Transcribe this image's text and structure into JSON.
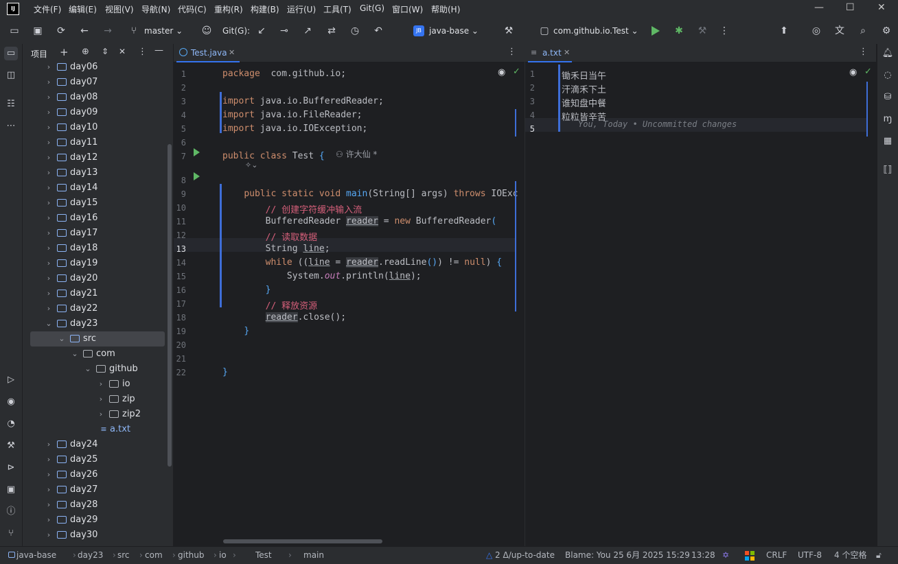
{
  "menu": [
    "文件(F)",
    "编辑(E)",
    "视图(V)",
    "导航(N)",
    "代码(C)",
    "重构(R)",
    "构建(B)",
    "运行(U)",
    "工具(T)",
    "Git(G)",
    "窗口(W)",
    "帮助(H)"
  ],
  "logo_text": "IJ",
  "toolbar": {
    "branch": "master",
    "git_label": "Git(G):",
    "project_badge": "JB",
    "project_name": "java-base",
    "run_config": "com.github.io.Test"
  },
  "project_panel": {
    "title": "项目",
    "tree": [
      {
        "label": "day06",
        "type": "folder",
        "depth": 1,
        "expanded": false
      },
      {
        "label": "day07",
        "type": "folder",
        "depth": 1,
        "expanded": false
      },
      {
        "label": "day08",
        "type": "folder",
        "depth": 1,
        "expanded": false
      },
      {
        "label": "day09",
        "type": "folder",
        "depth": 1,
        "expanded": false
      },
      {
        "label": "day10",
        "type": "folder",
        "depth": 1,
        "expanded": false
      },
      {
        "label": "day11",
        "type": "folder",
        "depth": 1,
        "expanded": false
      },
      {
        "label": "day12",
        "type": "folder",
        "depth": 1,
        "expanded": false
      },
      {
        "label": "day13",
        "type": "folder",
        "depth": 1,
        "expanded": false
      },
      {
        "label": "day14",
        "type": "folder",
        "depth": 1,
        "expanded": false
      },
      {
        "label": "day15",
        "type": "folder",
        "depth": 1,
        "expanded": false
      },
      {
        "label": "day16",
        "type": "folder",
        "depth": 1,
        "expanded": false
      },
      {
        "label": "day17",
        "type": "folder",
        "depth": 1,
        "expanded": false
      },
      {
        "label": "day18",
        "type": "folder",
        "depth": 1,
        "expanded": false
      },
      {
        "label": "day19",
        "type": "folder",
        "depth": 1,
        "expanded": false
      },
      {
        "label": "day20",
        "type": "folder",
        "depth": 1,
        "expanded": false
      },
      {
        "label": "day21",
        "type": "folder",
        "depth": 1,
        "expanded": false
      },
      {
        "label": "day22",
        "type": "folder",
        "depth": 1,
        "expanded": false
      },
      {
        "label": "day23",
        "type": "folder",
        "depth": 1,
        "expanded": true
      },
      {
        "label": "src",
        "type": "src",
        "depth": 2,
        "expanded": true,
        "selected": true
      },
      {
        "label": "com",
        "type": "package",
        "depth": 3,
        "expanded": true
      },
      {
        "label": "github",
        "type": "package",
        "depth": 4,
        "expanded": true
      },
      {
        "label": "io",
        "type": "package",
        "depth": 5,
        "expanded": false
      },
      {
        "label": "zip",
        "type": "package",
        "depth": 5,
        "expanded": false
      },
      {
        "label": "zip2",
        "type": "package",
        "depth": 5,
        "expanded": false
      },
      {
        "label": "a.txt",
        "type": "file",
        "depth": 3,
        "expanded": null
      },
      {
        "label": "day24",
        "type": "folder",
        "depth": 1,
        "expanded": false
      },
      {
        "label": "day25",
        "type": "folder",
        "depth": 1,
        "expanded": false
      },
      {
        "label": "day26",
        "type": "folder",
        "depth": 1,
        "expanded": false
      },
      {
        "label": "day27",
        "type": "folder",
        "depth": 1,
        "expanded": false
      },
      {
        "label": "day28",
        "type": "folder",
        "depth": 1,
        "expanded": false
      },
      {
        "label": "day29",
        "type": "folder",
        "depth": 1,
        "expanded": false
      },
      {
        "label": "day30",
        "type": "folder",
        "depth": 1,
        "expanded": false
      }
    ]
  },
  "editor_left": {
    "tab": "Test.java",
    "author_hint": "许大仙 *",
    "lines": [
      [
        [
          "kw",
          "package"
        ],
        [
          "",
          "  com.github.io;"
        ]
      ],
      [],
      [
        [
          "kw",
          "import"
        ],
        [
          "",
          " java.io.BufferedReader;"
        ]
      ],
      [
        [
          "kw",
          "import"
        ],
        [
          "",
          " java.io.FileReader;"
        ]
      ],
      [
        [
          "kw",
          "import"
        ],
        [
          "",
          " java.io.IOException;"
        ]
      ],
      [],
      [
        [
          "kw",
          "public class"
        ],
        [
          "",
          " Test "
        ],
        [
          "fn",
          "{"
        ]
      ],
      [],
      [
        [
          "",
          "    "
        ],
        [
          "kw",
          "public static void"
        ],
        [
          "",
          " "
        ],
        [
          "fn",
          "main"
        ],
        [
          "",
          "(String[] args) "
        ],
        [
          "kw",
          "throws"
        ],
        [
          "",
          " IOExc"
        ]
      ],
      [
        [
          "",
          "        "
        ],
        [
          "cm",
          "// 创建字符缓冲输入流"
        ]
      ],
      [
        [
          "",
          "        BufferedReader "
        ],
        [
          "var",
          "reader"
        ],
        [
          "",
          " = "
        ],
        [
          "kw",
          "new"
        ],
        [
          "",
          " BufferedReader"
        ],
        [
          "fn",
          "("
        ]
      ],
      [
        [
          "",
          "        "
        ],
        [
          "cm",
          "// 读取数据"
        ]
      ],
      [
        [
          "",
          "        String "
        ],
        [
          "u",
          "line"
        ],
        [
          "",
          ";"
        ]
      ],
      [
        [
          "",
          "        "
        ],
        [
          "kw",
          "while"
        ],
        [
          "",
          " (("
        ],
        [
          "u",
          "line"
        ],
        [
          "",
          " = "
        ],
        [
          "var",
          "reader"
        ],
        [
          "",
          ".readLine"
        ],
        [
          "fn",
          "()"
        ],
        [
          "",
          ") != "
        ],
        [
          "kw",
          "null"
        ],
        [
          "",
          ") "
        ],
        [
          "fn",
          "{"
        ]
      ],
      [
        [
          "",
          "            System."
        ],
        [
          "st",
          "out"
        ],
        [
          "",
          ".println("
        ],
        [
          "u",
          "line"
        ],
        [
          "",
          ");"
        ]
      ],
      [
        [
          "",
          "        "
        ],
        [
          "fn",
          "}"
        ]
      ],
      [
        [
          "",
          "        "
        ],
        [
          "cm",
          "// 释放资源"
        ]
      ],
      [
        [
          "",
          "        "
        ],
        [
          "var",
          "reader"
        ],
        [
          "",
          ".close();"
        ]
      ],
      [
        [
          "",
          "    "
        ],
        [
          "fn",
          "}"
        ]
      ],
      [],
      [],
      [
        [
          "fn",
          "}"
        ]
      ]
    ]
  },
  "editor_right": {
    "tab": "a.txt",
    "lines": [
      "锄禾日当午",
      "汗滴禾下土",
      "谁知盘中餐",
      "粒粒皆辛苦",
      ""
    ],
    "blame_hint": "You, Today • Uncommitted changes"
  },
  "status": {
    "breadcrumb": [
      "java-base",
      "day23",
      "src",
      "com",
      "github",
      "io",
      "Test",
      "main"
    ],
    "vcs": "2 Δ/up-to-date",
    "blame": "Blame: You 25 6月 2025 15:29",
    "position": "13:28",
    "line_sep": "CRLF",
    "encoding": "UTF-8",
    "indent": "4 个空格"
  }
}
